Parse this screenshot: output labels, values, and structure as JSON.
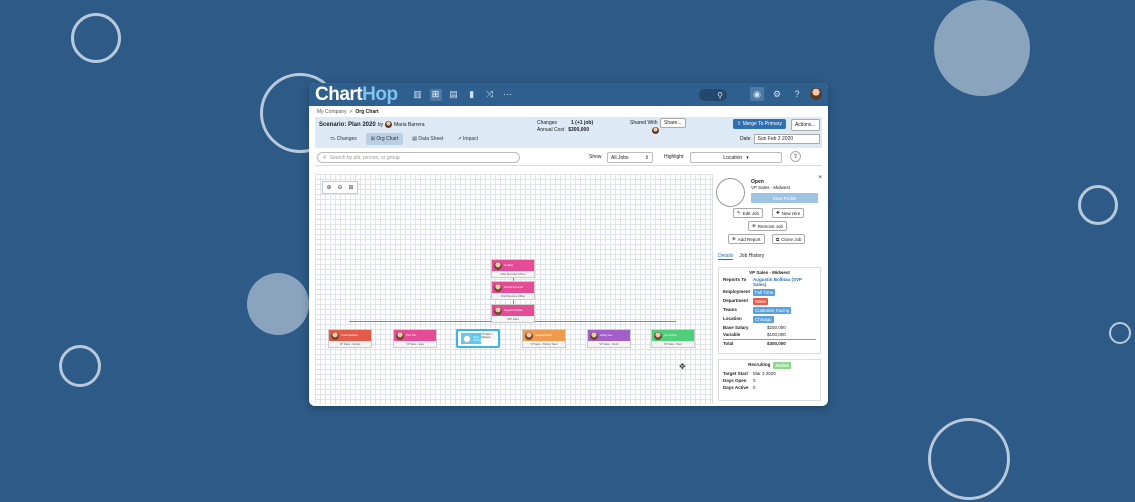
{
  "app": {
    "logo_main": "Chart",
    "logo_accent": "Hop"
  },
  "breadcrumb": {
    "root": "My Company",
    "sep": ">",
    "current": "Org Chart"
  },
  "scenario": {
    "title": "Scenario: Plan 2020",
    "by": "by",
    "owner": "Maria Barrera",
    "tabs": [
      "Changes",
      "Org Chart",
      "Data Sheet",
      "Impact"
    ],
    "changes_label": "Changes",
    "changes_value": "1 (+1 job)",
    "cost_label": "Annual Cost",
    "cost_value": "$300,000",
    "shared_label": "Shared With",
    "share_btn": "Share...",
    "merge_btn": "Merge To Primary",
    "actions_btn": "Actions...",
    "date_label": "Date",
    "date_value": "Sun Feb 2 2020"
  },
  "filters": {
    "search_placeholder": "Search by job, person, or group",
    "show_label": "Show",
    "show_value": "All Jobs",
    "highlight_label": "Highlight",
    "highlight_value": "Location"
  },
  "org": {
    "top": [
      {
        "name": "Liz Beta",
        "title": "Chief Executive Officer",
        "color": "#e64b95"
      },
      {
        "name": "Geraldine Kumar",
        "title": "Chief Revenue Officer",
        "color": "#e64b95"
      },
      {
        "name": "Augustin Bollitau",
        "title": "SVP Sales",
        "color": "#e64b95"
      }
    ],
    "reports": [
      {
        "name": "Lukas Martinez",
        "title": "VP Sales - Central",
        "color": "#e45b4a"
      },
      {
        "name": "Pam Kim",
        "title": "VP Sales - East",
        "color": "#e64b95"
      },
      {
        "name": "Open (Hiring)",
        "title": "VP Sales - Midwest",
        "color": "#5ec8ee"
      },
      {
        "name": "Garfield Powell",
        "title": "VP Sales - Partner Team",
        "color": "#ef9a4d"
      },
      {
        "name": "Jeffrey Lee",
        "title": "VP Sales - South",
        "color": "#a25fc9"
      },
      {
        "name": "Lynne Hunt",
        "title": "VP Sales - West",
        "color": "#4fcf7a"
      }
    ]
  },
  "panel": {
    "status": "Open",
    "role": "VP Sales - Midwest",
    "view_profile": "View Profile",
    "buttons": [
      "Edit Job",
      "New Hire",
      "Remove Job",
      "Add Report",
      "Clone Job"
    ],
    "tabs": [
      "Details",
      "Job History"
    ],
    "details_title": "VP Sales - Midwest",
    "reports_to_label": "Reports To",
    "reports_to": "Augustin Bollitau (SVP Sales)",
    "employment_label": "Employment",
    "employment": "Full Time",
    "department_label": "Department",
    "department": "Sales",
    "teams_label": "Teams",
    "teams": "Customer Facing",
    "location_label": "Location",
    "location": "Chicago",
    "base_label": "Base Salary",
    "base": "$200,000",
    "variable_label": "Variable",
    "variable": "$100,000",
    "total_label": "Total",
    "total": "$300,000",
    "recruiting_label": "Recruiting",
    "recruiting_badge": "Active",
    "target_label": "Target Start",
    "target": "Mar 3 2020",
    "open_label": "Days Open",
    "open": "0",
    "active_label": "Days Active",
    "active": "0"
  },
  "colors": {
    "brand": "#2e5f8f",
    "accent": "#2e6fb0",
    "background": "#2d5a86"
  }
}
